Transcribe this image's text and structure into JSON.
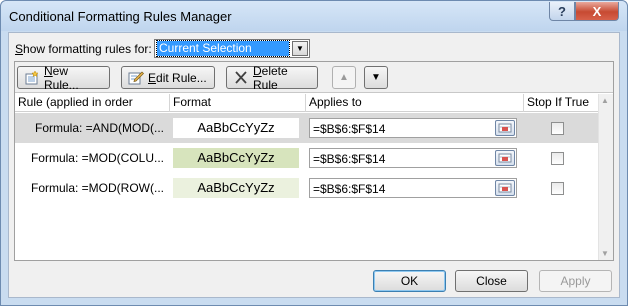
{
  "window": {
    "title": "Conditional Formatting Rules Manager",
    "help_symbol": "?",
    "close_symbol": "X"
  },
  "scope": {
    "label_prefix": "",
    "label_hotkey": "S",
    "label_rest": "how formatting rules for:",
    "selected_value": "Current Selection"
  },
  "toolbar": {
    "new_rule": {
      "hotkey": "N",
      "rest": "ew Rule..."
    },
    "edit_rule": {
      "hotkey": "E",
      "rest": "dit Rule..."
    },
    "delete_rule": {
      "hotkey": "D",
      "rest": "elete Rule"
    },
    "move_up_symbol": "▲",
    "move_down_symbol": "▼"
  },
  "columns": {
    "rule": "Rule (applied in order shown)",
    "format": "Format",
    "applies_to": "Applies to",
    "stop_if_true": "Stop If True"
  },
  "rules": [
    {
      "rule": "Formula: =AND(MOD(...",
      "format_preview": "AaBbCcYyZz",
      "format_fill": "#ffffff",
      "applies_to": "=$B$6:$F$14",
      "stop_if_true": false
    },
    {
      "rule": "Formula: =MOD(COLU...",
      "format_preview": "AaBbCcYyZz",
      "format_fill": "#d7e4bd",
      "applies_to": "=$B$6:$F$14",
      "stop_if_true": false
    },
    {
      "rule": "Formula: =MOD(ROW(...",
      "format_preview": "AaBbCcYyZz",
      "format_fill": "#ebf1de",
      "applies_to": "=$B$6:$F$14",
      "stop_if_true": false
    }
  ],
  "buttons": {
    "ok": "OK",
    "close": "Close",
    "apply": "Apply"
  },
  "colors": {
    "selection_highlight": "#3399ff",
    "selected_row": "#dadada"
  },
  "icons": {
    "new_rule": "new-document-icon",
    "edit_rule": "edit-icon",
    "delete_rule": "delete-x-icon",
    "range_picker": "range-select-icon"
  }
}
